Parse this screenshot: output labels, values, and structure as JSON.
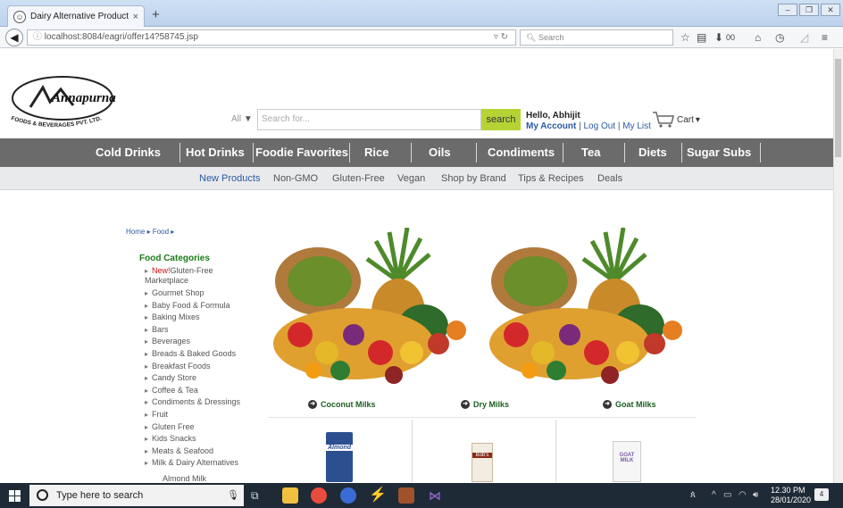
{
  "browser": {
    "tab_title": "Dairy Alternative Products |...",
    "tab_close": "×",
    "new_tab": "+",
    "url": "localhost:8084/eagri/offer14?58745.jsp",
    "search_placeholder": "Search",
    "download_count": "00"
  },
  "site": {
    "brand": "Annapurna",
    "brand_sub": "FOODS & BEVERAGES PVT. LTD.",
    "search_category": "All",
    "search_placeholder": "Search for...",
    "search_button": "search",
    "greeting": "Hello, Abhijit",
    "account_link": "My Account",
    "logout_link": "Log Out",
    "list_link": "My List",
    "cart_label": "Cart",
    "main_nav": [
      "Cold Drinks",
      "Hot Drinks",
      "Foodie Favorites",
      "Rice",
      "Oils",
      "Condiments",
      "Tea",
      "Diets",
      "Sugar Subs"
    ],
    "sub_nav": [
      "New Products",
      "Non-GMO",
      "Gluten-Free",
      "Vegan",
      "Shop by Brand",
      "Tips & Recipes",
      "Deals"
    ],
    "breadcrumb": "Home ▸ Food ▸",
    "category_heading": "Food Categories",
    "categories_first_new": "New!",
    "categories_first_rest_1": "Gluten-Free",
    "categories_first_rest_2": "Marketplace",
    "categories": [
      "Gourmet Shop",
      "Baby Food & Formula",
      "Baking Mixes",
      "Bars",
      "Beverages",
      "Breads & Baked Goods",
      "Breakfast Foods",
      "Candy Store",
      "Coffee & Tea",
      "Condiments & Dressings",
      "Fruit",
      "Gluten Free",
      "Kids Snacks",
      "Meats & Seafood",
      "Milk & Dairy Alternatives"
    ],
    "subcategory": "Almond Milk",
    "products": [
      "Coconut Milks",
      "Dry Milks",
      "Goat Milks"
    ],
    "pack_labels": [
      "Almond",
      "Bob's",
      "GOAT MILK"
    ]
  },
  "taskbar": {
    "search_placeholder": "Type here to search",
    "time": "12.30 PM",
    "date": "28/01/2020",
    "notification_count": "4"
  },
  "colors": {
    "nav_bg": "#6b6b6b",
    "search_button": "#b5d334",
    "category_heading": "#1b7a1b",
    "link": "#2a5aa3",
    "taskbar": "#1e2a36"
  }
}
